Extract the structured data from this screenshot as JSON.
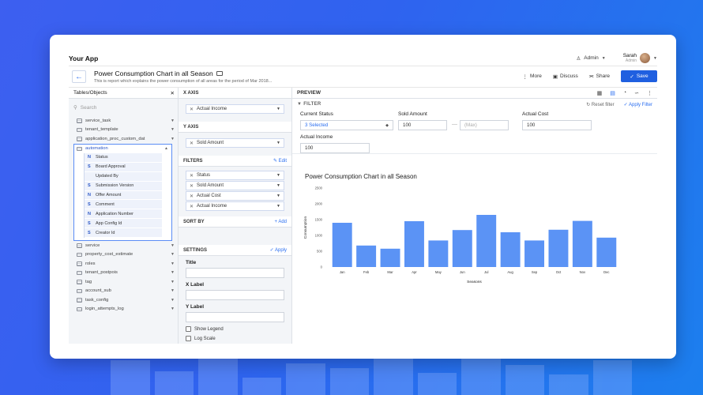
{
  "app": {
    "title": "Your App"
  },
  "topbar": {
    "admin_label": "Admin",
    "user_name": "Sarah",
    "user_role": "Admin"
  },
  "header": {
    "back_label": "←",
    "title": "Power Consumption Chart in all Season",
    "description": "This is report which explains the power consumption of all areas for the period of Mar 2018...",
    "actions": {
      "more": "More",
      "discuss": "Discuss",
      "share": "Share",
      "save": "Save"
    }
  },
  "tables_panel": {
    "title": "Tables/Objects",
    "search_placeholder": "Search",
    "tables_before": [
      "service_task",
      "tenant_template",
      "application_proc_custom_dat"
    ],
    "expanded_table": "automation",
    "fields": [
      {
        "type": "N",
        "name": "Status"
      },
      {
        "type": "S",
        "name": "Board Approval"
      },
      {
        "type": "",
        "name": "Updated By"
      },
      {
        "type": "S",
        "name": "Submission Version"
      },
      {
        "type": "N",
        "name": "Offer Amount"
      },
      {
        "type": "S",
        "name": "Comment"
      },
      {
        "type": "N",
        "name": "Application Number"
      },
      {
        "type": "S",
        "name": "App Config Id"
      },
      {
        "type": "S",
        "name": "Creator Id"
      }
    ],
    "tables_after": [
      "service",
      "property_cost_estimate",
      "roles",
      "tenant_postpois",
      "tag",
      "account_sub",
      "task_config",
      "login_attempts_log"
    ]
  },
  "config_panel": {
    "x_axis": {
      "label": "X AXIS",
      "value": "Actual Income"
    },
    "y_axis": {
      "label": "Y AXIS",
      "value": "Sold Amount"
    },
    "filters": {
      "label": "FILTERS",
      "edit": "Edit",
      "items": [
        "Status",
        "Sold Amount",
        "Actual Cost",
        "Actual Income"
      ]
    },
    "sort_by": {
      "label": "SORT BY",
      "add": "Add"
    },
    "settings": {
      "label": "SETTINGS",
      "apply": "Apply",
      "title_label": "Title",
      "x_label": "X Label",
      "y_label": "Y Label",
      "show_legend": "Show Legend",
      "log_scale": "Log Scale"
    }
  },
  "preview": {
    "label": "PREVIEW",
    "filter_label": "FILTER",
    "reset_filter": "Reset filter",
    "apply_filter": "Apply Filter",
    "current_status": {
      "label": "Current Status",
      "value": "3 Selected"
    },
    "sold_amount": {
      "label": "Sold Amount",
      "min": "100",
      "max_placeholder": "(Max)"
    },
    "actual_cost": {
      "label": "Actual Cost",
      "value": "100"
    },
    "actual_income": {
      "label": "Actual Income",
      "value": "100"
    }
  },
  "colors": {
    "accent": "#2a6ef0",
    "bar": "#5b93f5",
    "save_button": "#1f5fe0"
  },
  "chart_data": {
    "type": "bar",
    "title": "Power Consumption Chart in all Season",
    "xlabel": "Seasons",
    "ylabel": "Consumption",
    "categories": [
      "Jan",
      "Feb",
      "Mar",
      "Apr",
      "May",
      "Jun",
      "Jul",
      "Aug",
      "Sep",
      "Oct",
      "Nov",
      "Dec"
    ],
    "values": [
      1400,
      680,
      580,
      1450,
      840,
      1170,
      1650,
      1100,
      840,
      1180,
      1460,
      930
    ],
    "yticks": [
      "0",
      "500",
      "1000",
      "1500",
      "2000",
      "2500"
    ],
    "ylim": [
      0,
      2500
    ],
    "grid": false,
    "legend": false
  }
}
